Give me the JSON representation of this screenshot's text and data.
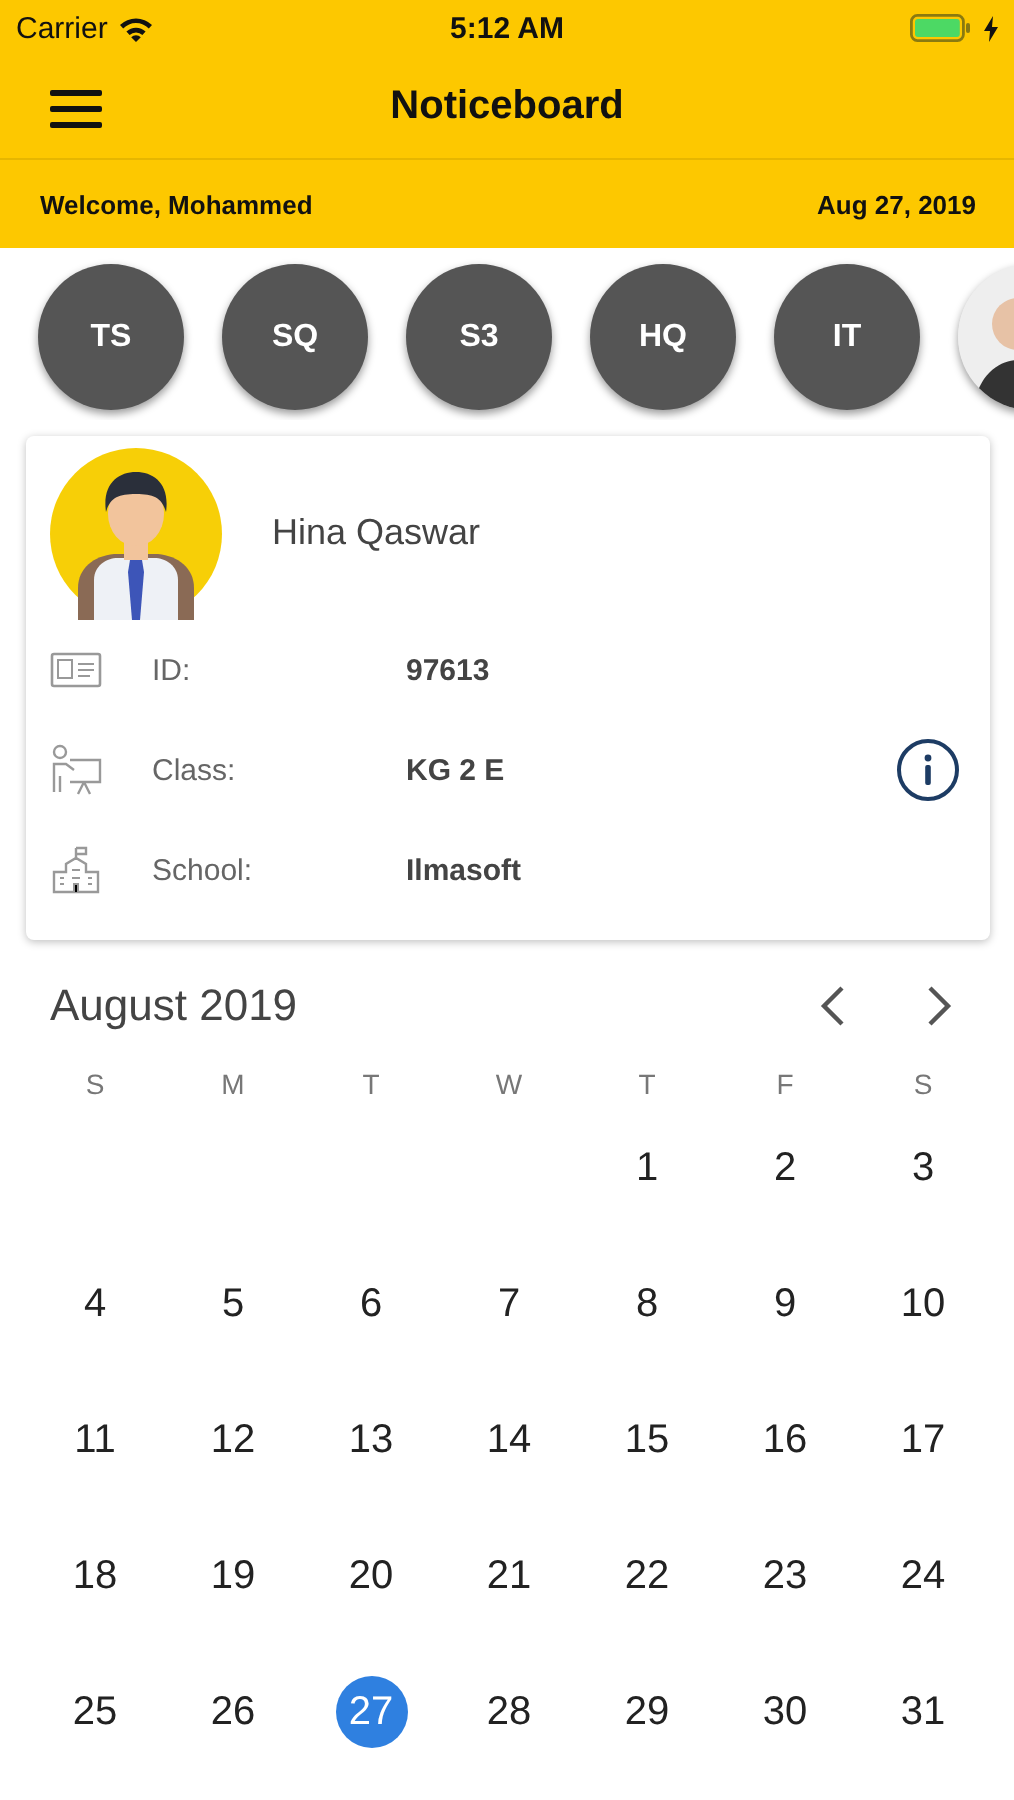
{
  "status_bar": {
    "carrier": "Carrier",
    "time": "5:12 AM",
    "charging": true
  },
  "header": {
    "title": "Noticeboard"
  },
  "welcome": {
    "greeting": "Welcome, Mohammed",
    "date": "Aug 27, 2019"
  },
  "students": [
    {
      "kind": "initials",
      "label": "TS",
      "selected": false
    },
    {
      "kind": "initials",
      "label": "SQ",
      "selected": false
    },
    {
      "kind": "initials",
      "label": "S3",
      "selected": false
    },
    {
      "kind": "initials",
      "label": "HQ",
      "selected": false
    },
    {
      "kind": "initials",
      "label": "IT",
      "selected": false
    },
    {
      "kind": "photo",
      "selected": false
    }
  ],
  "profile": {
    "name": "Hina Qaswar",
    "fields": [
      {
        "kind": "id",
        "label": "ID:",
        "value": "97613"
      },
      {
        "kind": "class",
        "label": "Class:",
        "value": "KG 2 E"
      },
      {
        "kind": "school",
        "label": "School:",
        "value": "Ilmasoft"
      }
    ]
  },
  "calendar": {
    "month": "August 2019",
    "weekdays": [
      "S",
      "M",
      "T",
      "W",
      "T",
      "F",
      "S"
    ],
    "weeks": [
      [
        {
          "day": "1",
          "selected": false
        },
        {
          "day": "2",
          "selected": false
        },
        {
          "day": "3",
          "selected": false
        }
      ],
      [
        {
          "day": "4",
          "selected": false
        },
        {
          "day": "5",
          "selected": false
        },
        {
          "day": "6",
          "selected": false
        },
        {
          "day": "7",
          "selected": false
        },
        {
          "day": "8",
          "selected": false
        },
        {
          "day": "9",
          "selected": false
        },
        {
          "day": "10",
          "selected": false
        }
      ],
      [
        {
          "day": "11",
          "selected": false
        },
        {
          "day": "12",
          "selected": false
        },
        {
          "day": "13",
          "selected": false
        },
        {
          "day": "14",
          "selected": false
        },
        {
          "day": "15",
          "selected": false
        },
        {
          "day": "16",
          "selected": false
        },
        {
          "day": "17",
          "selected": false
        }
      ],
      [
        {
          "day": "18",
          "selected": false
        },
        {
          "day": "19",
          "selected": false
        },
        {
          "day": "20",
          "selected": false
        },
        {
          "day": "21",
          "selected": false
        },
        {
          "day": "22",
          "selected": false
        },
        {
          "day": "23",
          "selected": false
        },
        {
          "day": "24",
          "selected": false
        }
      ],
      [
        {
          "day": "25",
          "selected": false
        },
        {
          "day": "26",
          "selected": false
        },
        {
          "day": "27",
          "selected": true
        },
        {
          "day": "28",
          "selected": false
        },
        {
          "day": "29",
          "selected": false
        },
        {
          "day": "30",
          "selected": false
        },
        {
          "day": "31",
          "selected": false
        }
      ]
    ]
  }
}
